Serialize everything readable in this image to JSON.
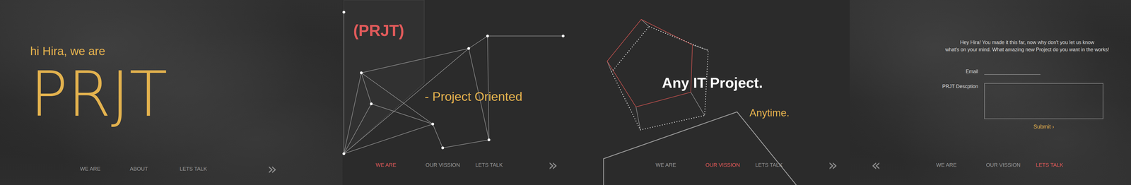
{
  "panels": [
    {
      "kind": "intro",
      "greeting": "hi Hira, we are",
      "logo": "PRJT",
      "nav": {
        "arrow": "»",
        "arrow_kind": "next",
        "items": [
          {
            "label": "WE ARE",
            "selected": false
          },
          {
            "label": "ABOUT",
            "selected": false
          },
          {
            "label": "LETS TALK",
            "selected": false
          }
        ]
      }
    },
    {
      "kind": "about",
      "title": "(PRJT)",
      "tagline": "- Project Oriented",
      "nav": {
        "arrow": "»",
        "arrow_kind": "next",
        "items": [
          {
            "label": "WE ARE",
            "selected": true
          },
          {
            "label": "OUR VISSION",
            "selected": false
          },
          {
            "label": "LETS TALK",
            "selected": false
          }
        ]
      }
    },
    {
      "kind": "vision",
      "headline": "Any IT Project.",
      "tagline": "Anytime.",
      "nav": {
        "arrow": "»",
        "arrow_kind": "next",
        "items": [
          {
            "label": "WE ARE",
            "selected": false
          },
          {
            "label": "OUR VISSION",
            "selected": true
          },
          {
            "label": "LETS TALK",
            "selected": false
          }
        ]
      }
    },
    {
      "kind": "contact",
      "message": [
        "Hey Hira! You made it this far, now why don't you let us know",
        "what's on your mind. What amazing new Project do you want in the works!"
      ],
      "fields": [
        {
          "label": "Email",
          "kind": "input"
        },
        {
          "label": "PRJT Descption",
          "kind": "textarea"
        }
      ],
      "submit": {
        "label": "Submit",
        "icon": "›"
      },
      "nav": {
        "arrow": "«",
        "arrow_kind": "back",
        "items": [
          {
            "label": "WE ARE",
            "selected": false
          },
          {
            "label": "OUR VISSION",
            "selected": false
          },
          {
            "label": "LETS TALK",
            "selected": true
          }
        ]
      }
    }
  ]
}
